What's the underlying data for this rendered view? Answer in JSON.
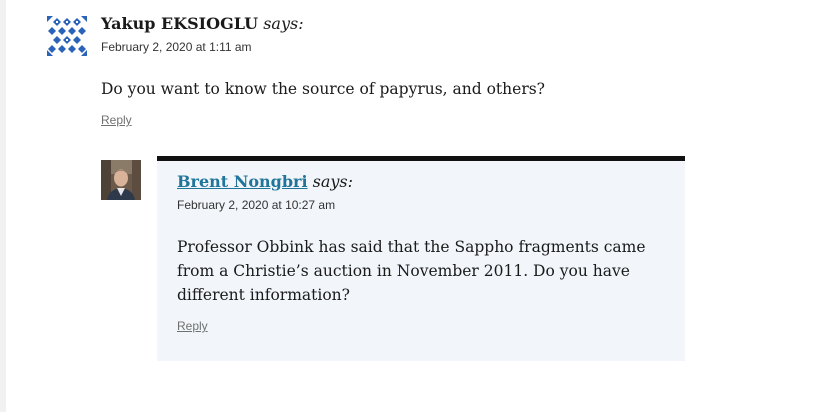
{
  "comments": [
    {
      "author": "Yakup EKSIOGLU",
      "says": "says:",
      "date": "February 2, 2020 at 1:11 am",
      "body": [
        "Do you want to know the source of papyrus, and others?"
      ],
      "reply_label": "Reply",
      "avatar": "geometric-pattern-avatar-icon"
    },
    {
      "author": "Brent Nongbri",
      "says": "says:",
      "date": "February 2, 2020 at 10:27 am",
      "body": [
        "Professor Obbink has said that the Sappho fragments came from a Christie’s auction in November 2011. Do you have different information?"
      ],
      "reply_label": "Reply",
      "avatar": "user-photo-avatar"
    }
  ],
  "colors": {
    "link": "#21759b",
    "child_bg": "#f2f6fa",
    "accent_border": "#111111",
    "avatar_pattern": "#2a63b8"
  }
}
